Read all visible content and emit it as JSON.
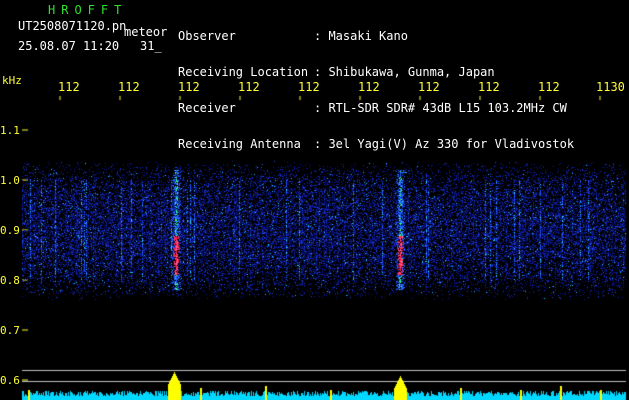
{
  "header": {
    "logo": "HROFFT",
    "file_name": "UT2508071120.pn",
    "label_meteor": "meteor",
    "date_time": "25.08.07 11:20",
    "count": "31_"
  },
  "station": [
    {
      "key": "Observer",
      "value": ": Masaki Kano"
    },
    {
      "key": "Receiving Location",
      "value": ": Shibukawa, Gunma, Japan"
    },
    {
      "key": "Receiver",
      "value": ": RTL-SDR SDR# 43dB L15 103.2MHz CW"
    },
    {
      "key": "Receiving Antenna",
      "value": ": 3el Yagi(V) Az 330 for Vladivostok"
    }
  ],
  "axis": {
    "y_unit": "kHz",
    "x_ticks": [
      "112",
      "112",
      "112",
      "112",
      "112",
      "112",
      "112",
      "112",
      "112",
      "1130"
    ],
    "y_ticks": [
      "1.1",
      "1.0",
      "0.9",
      "0.8",
      "0.7",
      "0.6"
    ]
  },
  "colors": {
    "background": "#000000",
    "axis_text": "#ffff33",
    "logo": "#2fe02f",
    "spectrum_low": "#1020a0",
    "spectrum_high": "#ff2040",
    "level_bar": "#00d8ff",
    "level_peak": "#ffff00"
  },
  "events": [
    {
      "label": "meteor-echo-1"
    },
    {
      "label": "meteor-echo-2"
    }
  ]
}
